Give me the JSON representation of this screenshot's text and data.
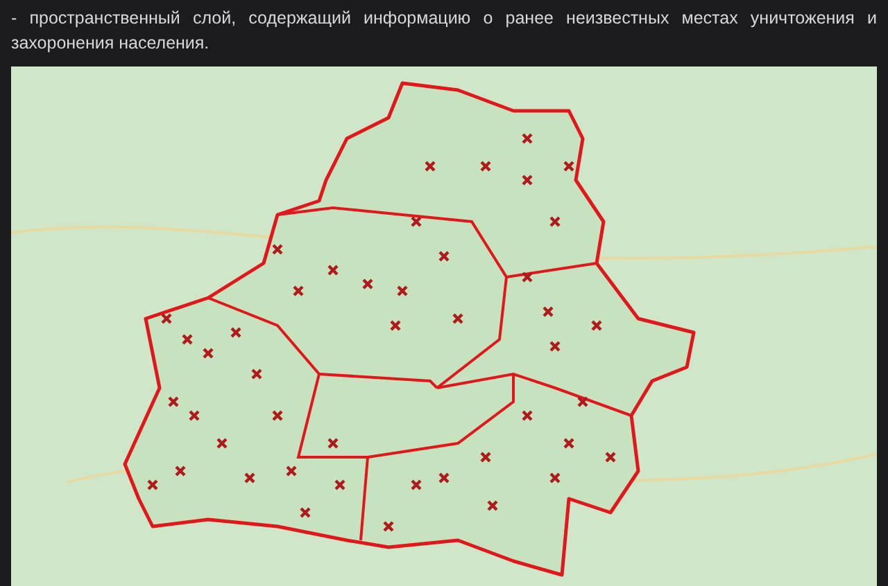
{
  "caption": "- пространственный слой, содержащий информацию о ранее неизвестных местах уничтожения и захоронения населения."
}
